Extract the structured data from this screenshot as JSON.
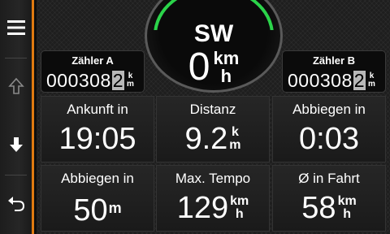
{
  "sidebar": {
    "menu_icon": "hamburger-menu-icon",
    "up_icon": "arrow-up-icon",
    "down_icon": "arrow-down-icon",
    "back_icon": "back-arrow-icon"
  },
  "compass": {
    "heading": "SW",
    "speed": "0",
    "speed_unit_top": "km",
    "speed_unit_bottom": "h",
    "ring_color": "#2bd44a"
  },
  "counter_a": {
    "label": "Zähler A",
    "value": "000308",
    "last_digit": "2",
    "unit_top": "k",
    "unit_bottom": "m"
  },
  "counter_b": {
    "label": "Zähler B",
    "value": "000308",
    "last_digit": "2",
    "unit_top": "k",
    "unit_bottom": "m"
  },
  "tiles": [
    {
      "label": "Ankunft in",
      "value": "19:05",
      "unit_top": "",
      "unit_bottom": "",
      "unit": ""
    },
    {
      "label": "Distanz",
      "value": "9.2",
      "unit_top": "k",
      "unit_bottom": "m",
      "unit": ""
    },
    {
      "label": "Abbiegen in",
      "value": "0:03",
      "unit_top": "",
      "unit_bottom": "",
      "unit": ""
    },
    {
      "label": "Abbiegen in",
      "value": "50",
      "unit_top": "",
      "unit_bottom": "",
      "unit": "m"
    },
    {
      "label": "Max. Tempo",
      "value": "129",
      "unit_top": "km",
      "unit_bottom": "h",
      "unit": ""
    },
    {
      "label": "Ø in Fahrt",
      "value": "58",
      "unit_top": "km",
      "unit_bottom": "h",
      "unit": ""
    }
  ],
  "colors": {
    "accent": "#e07a10",
    "background": "#1e1e1e"
  }
}
